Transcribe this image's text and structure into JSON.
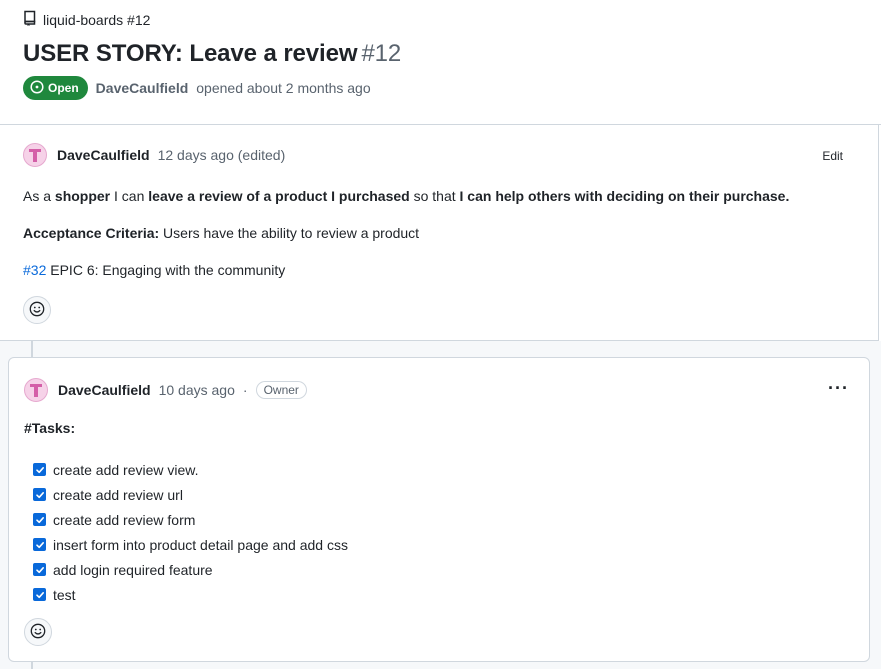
{
  "repo": {
    "label": "liquid-boards #12",
    "icon": "repo-icon"
  },
  "issue": {
    "title": "USER STORY: Leave a review",
    "number": "#12",
    "status": "Open",
    "author": "DaveCaulfield",
    "opened_text": "opened about 2 months ago",
    "status_color": "#1f883d"
  },
  "comment1": {
    "author": "DaveCaulfield",
    "time": "12 days ago (edited)",
    "edit_label": "Edit",
    "line1": {
      "p1": "As a ",
      "b1": "shopper",
      "p2": " I can ",
      "b2": "leave a review of a product I purchased",
      "p3": " so that ",
      "b3": "I can help others with deciding on their purchase."
    },
    "line2": {
      "b1": "Acceptance Criteria:",
      "p1": " Users have the ability to review a product"
    },
    "line3": {
      "link": "#32",
      "p1": " EPIC 6: Engaging with the community"
    }
  },
  "comment2": {
    "author": "DaveCaulfield",
    "time": "10 days ago",
    "separator": "·",
    "badge": "Owner",
    "menu_label": "···",
    "tasks_title": "#Tasks:",
    "tasks": [
      {
        "label": "create add review view.",
        "checked": true
      },
      {
        "label": "create add review url",
        "checked": true
      },
      {
        "label": "create add review form",
        "checked": true
      },
      {
        "label": "insert form into product detail page and add css",
        "checked": true
      },
      {
        "label": "add login required feature",
        "checked": true
      },
      {
        "label": "test",
        "checked": true
      }
    ]
  },
  "colors": {
    "link": "#0969da",
    "checkbox": "#0969da",
    "border": "#d0d7de"
  }
}
